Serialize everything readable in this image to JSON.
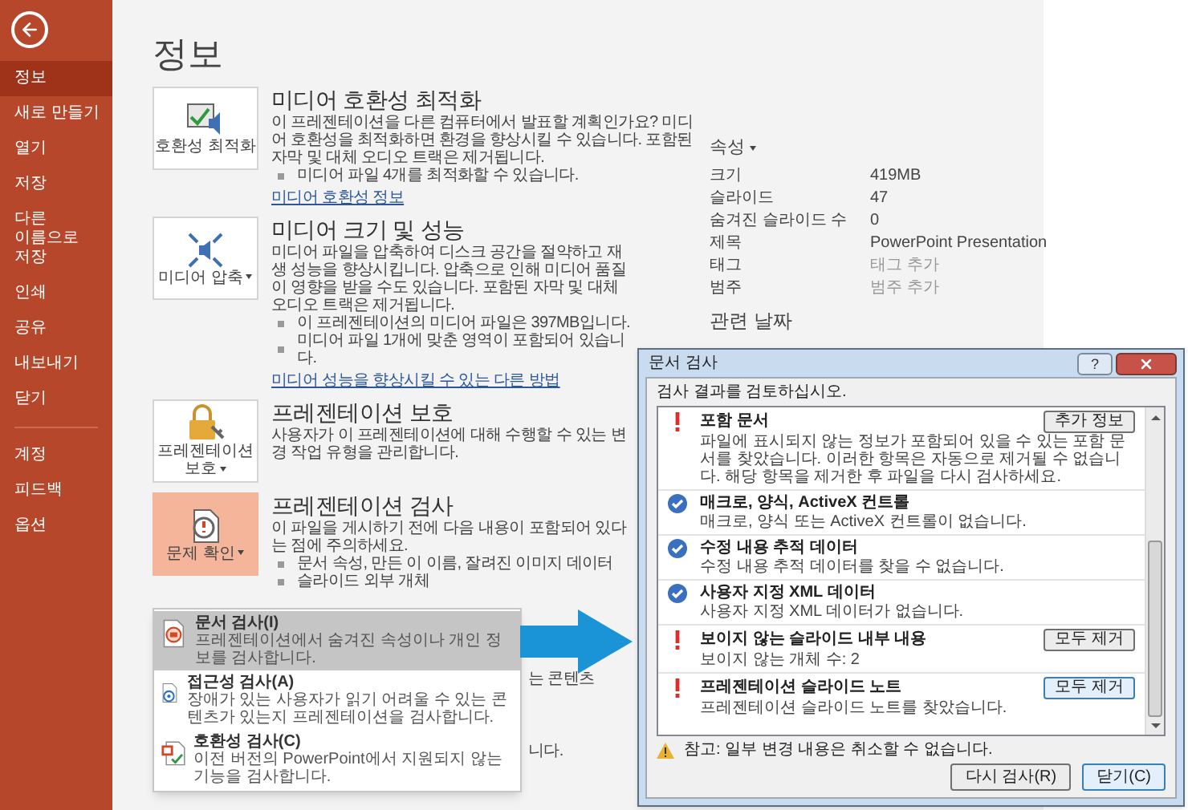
{
  "sidebar": {
    "items": [
      {
        "label": "정보",
        "selected": true
      },
      {
        "label": "새로 만들기",
        "selected": false
      },
      {
        "label": "열기",
        "selected": false
      },
      {
        "label": "저장",
        "selected": false
      },
      {
        "label": "다른 이름으로 저장",
        "selected": false
      },
      {
        "label": "인쇄",
        "selected": false
      },
      {
        "label": "공유",
        "selected": false
      },
      {
        "label": "내보내기",
        "selected": false
      },
      {
        "label": "닫기",
        "selected": false
      }
    ],
    "bottom_items": [
      {
        "label": "계정",
        "selected": false
      },
      {
        "label": "피드백",
        "selected": false
      },
      {
        "label": "옵션",
        "selected": false
      }
    ]
  },
  "page_title": "정보",
  "sections": [
    {
      "kind": "compat",
      "tile_label": "호환성 최적화",
      "dropdown": false,
      "selected": false,
      "title": "미디어 호환성 최적화",
      "body": "이 프레젠테이션을 다른 컴퓨터에서 발표할 계획인가요? 미디어 호환성을 최적화하면 환경을 향상시킬 수 있습니다. 포함된 자막 및 대체 오디오 트랙은 제거됩니다.",
      "bullets": [
        "미디어 파일 4개를 최적화할 수 있습니다."
      ],
      "link": "미디어 호환성 정보"
    },
    {
      "kind": "compress",
      "tile_label": "미디어 압축",
      "dropdown": true,
      "selected": false,
      "title": "미디어 크기 및 성능",
      "body": "미디어 파일을 압축하여 디스크 공간을 절약하고 재생 성능을 향상시킵니다. 압축으로 인해 미디어 품질이 영향을 받을 수도 있습니다. 포함된 자막 및 대체 오디오 트랙은 제거됩니다.",
      "bullets": [
        "이 프레젠테이션의 미디어 파일은 397MB입니다.",
        "미디어 파일 1개에 맞춘 영역이 포함되어 있습니다."
      ],
      "link": "미디어 성능을 향상시킬 수 있는 다른 방법"
    },
    {
      "kind": "protect",
      "tile_label": "프레젠테이션 보호",
      "dropdown": true,
      "selected": false,
      "title": "프레젠테이션 보호",
      "body": "사용자가 이 프레젠테이션에 대해 수행할 수 있는 변경 작업 유형을 관리합니다."
    },
    {
      "kind": "inspect",
      "tile_label": "문제 확인",
      "dropdown": true,
      "selected": true,
      "title": "프레젠테이션 검사",
      "body": "이 파일을 게시하기 전에 다음 내용이 포함되어 있다는 점에 주의하세요.",
      "bullets": [
        "문서 속성, 만든 이 이름, 잘려진 이미지 데이터",
        "슬라이드 외부 개체"
      ],
      "obscured_lines": [
        "는 콘텐츠",
        "니다."
      ]
    }
  ],
  "properties": {
    "heading": "속성",
    "rows": [
      {
        "label": "크기",
        "value": "419MB",
        "muted": false
      },
      {
        "label": "슬라이드",
        "value": "47",
        "muted": false
      },
      {
        "label": "숨겨진 슬라이드 수",
        "value": "0",
        "muted": false
      },
      {
        "label": "제목",
        "value": "PowerPoint Presentation",
        "muted": false
      },
      {
        "label": "태그",
        "value": "태그 추가",
        "muted": true
      },
      {
        "label": "범주",
        "value": "범주 추가",
        "muted": true
      }
    ],
    "related_heading": "관련 날짜"
  },
  "menu": {
    "items": [
      {
        "kind": "document",
        "title": "문서 검사(I)",
        "description": "프레젠테이션에서 숨겨진 속성이나 개인 정보를 검사합니다.",
        "selected": true
      },
      {
        "kind": "accessibility",
        "title": "접근성 검사(A)",
        "description": "장애가 있는 사용자가 읽기 어려울 수 있는 콘텐츠가 있는지 프레젠테이션을 검사합니다.",
        "selected": false
      },
      {
        "kind": "compatibility",
        "title": "호환성 검사(C)",
        "description": "이전 버전의 PowerPoint에서 지원되지 않는 기능을 검사합니다.",
        "selected": false
      }
    ]
  },
  "dialog": {
    "title": "문서 검사",
    "help": "?",
    "instruction": "검사 결과를 검토하십시오.",
    "results": [
      {
        "kind": "warning",
        "title": "포함 문서",
        "description": "파일에 표시되지 않는 정보가 포함되어 있을 수 있는 포함 문서를 찾았습니다. 이러한 항목은 자동으로 제거될 수 없습니다. 해당 항목을 제거한 후 파일을 다시 검사하세요.",
        "action": "추가 정보",
        "focused": false
      },
      {
        "kind": "ok",
        "title": "매크로, 양식, ActiveX 컨트롤",
        "description": "매크로, 양식 또는 ActiveX 컨트롤이 없습니다."
      },
      {
        "kind": "ok",
        "title": "수정 내용 추적 데이터",
        "description": "수정 내용 추적 데이터를 찾을 수 없습니다."
      },
      {
        "kind": "ok",
        "title": "사용자 지정 XML 데이터",
        "description": "사용자 지정 XML 데이터가 없습니다."
      },
      {
        "kind": "warning",
        "title": "보이지 않는 슬라이드 내부 내용",
        "description": "보이지 않는 개체 수: 2",
        "action": "모두 제거",
        "focused": false
      },
      {
        "kind": "warning",
        "title": "프레젠테이션 슬라이드 노트",
        "description": "프레젠테이션 슬라이드 노트를 찾았습니다.",
        "action": "모두 제거",
        "focused": true
      }
    ],
    "note": "참고: 일부 변경 내용은 취소할 수 없습니다.",
    "buttons": [
      {
        "label": "다시 검사(R)",
        "focused": false
      },
      {
        "label": "닫기(C)",
        "focused": true
      }
    ]
  }
}
